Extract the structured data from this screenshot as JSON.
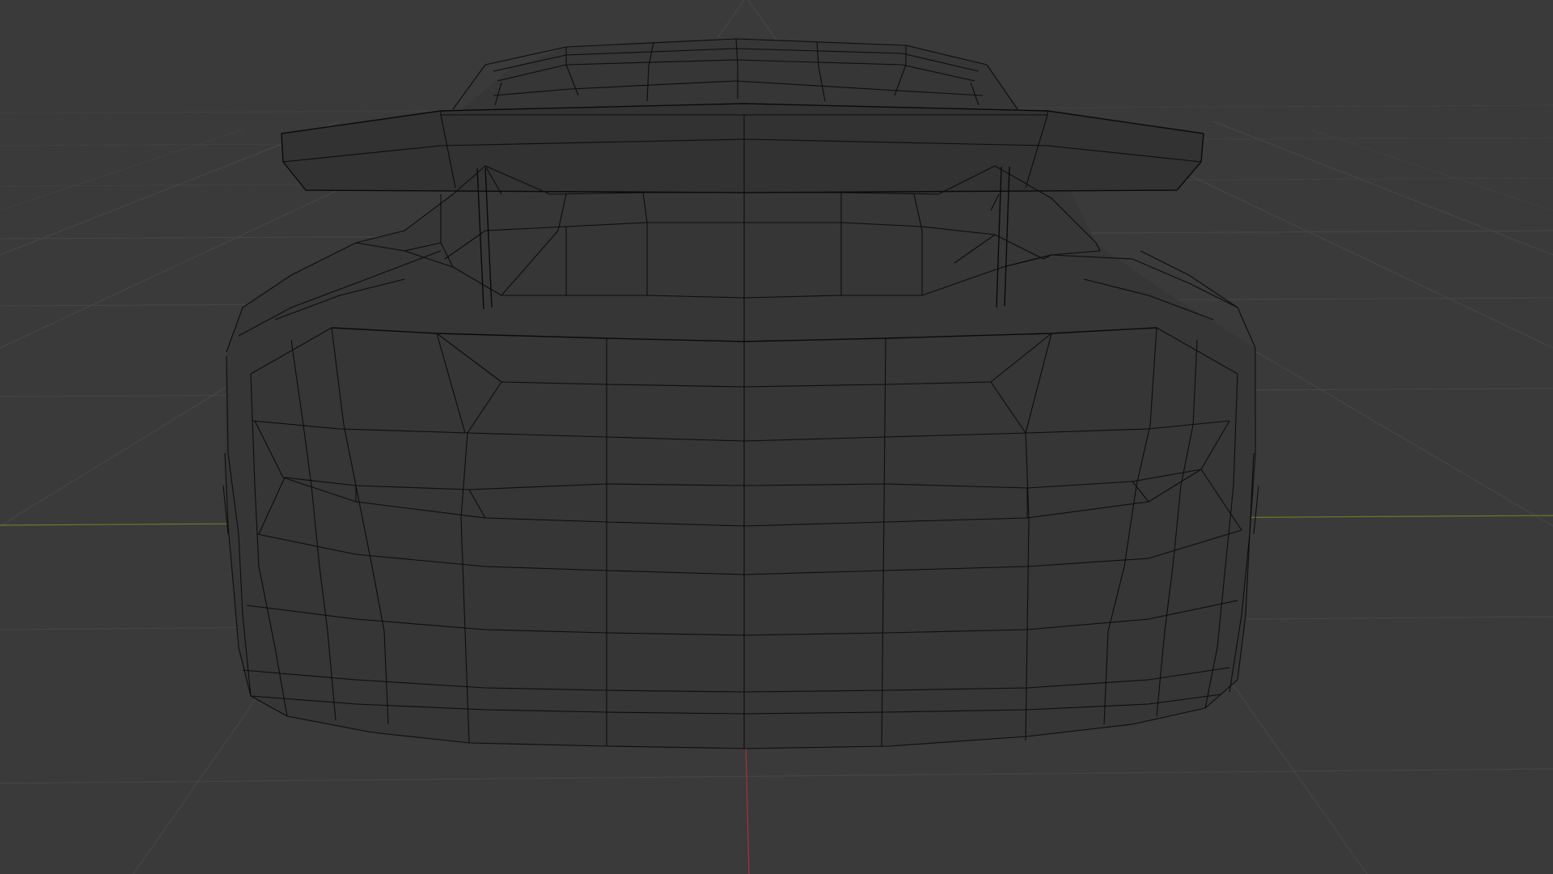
{
  "viewport": {
    "background": "#3a3a3a",
    "grid_color": "#474747",
    "x_axis_color": "#6b7a2e",
    "y_axis_color": "#a8323a",
    "wire_color": "#0d0d0d",
    "shading": "wireframe"
  }
}
